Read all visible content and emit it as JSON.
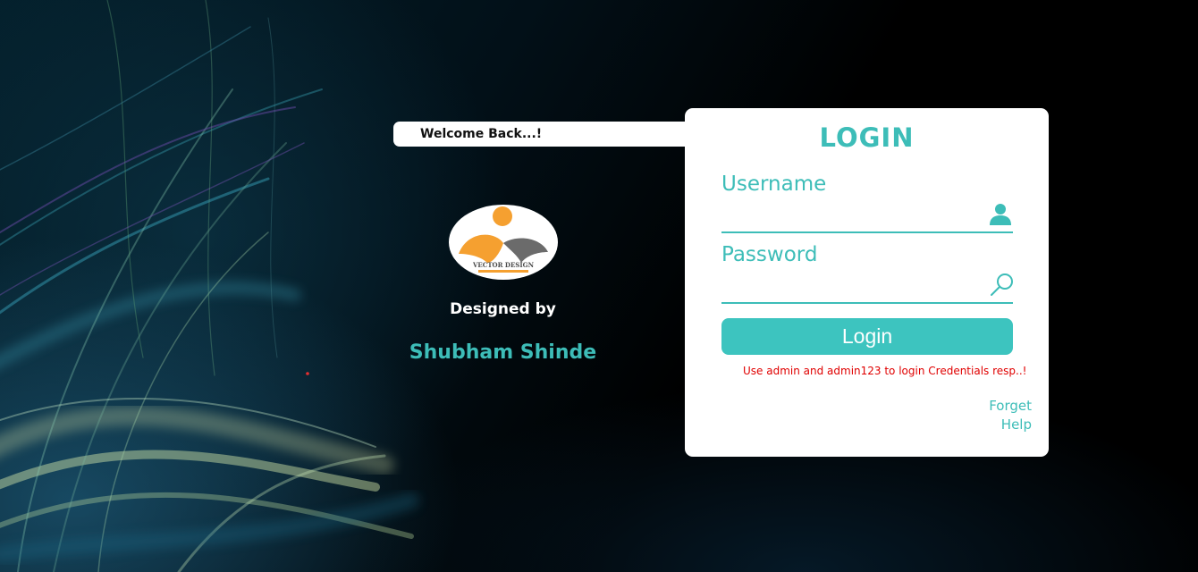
{
  "welcome": {
    "text": "Welcome Back...!"
  },
  "brand": {
    "logo_text": "VECTOR DESIGN",
    "designed_by": "Designed by",
    "author": "Shubham Shinde"
  },
  "login": {
    "title": "LOGIN",
    "username_label": "Username",
    "username_value": "",
    "password_label": "Password",
    "password_value": "",
    "button_label": "Login",
    "hint": "Use admin and admin123 to login Credentials resp..!",
    "forget_link": "Forget",
    "help_link": "Help"
  },
  "icons": {
    "username": "user-icon",
    "password": "search-icon"
  },
  "colors": {
    "accent": "#3dbdb8",
    "button": "#3dc4bf",
    "hint": "#e00000",
    "logo_orange": "#f5a030",
    "logo_gray": "#6b6b6b"
  }
}
